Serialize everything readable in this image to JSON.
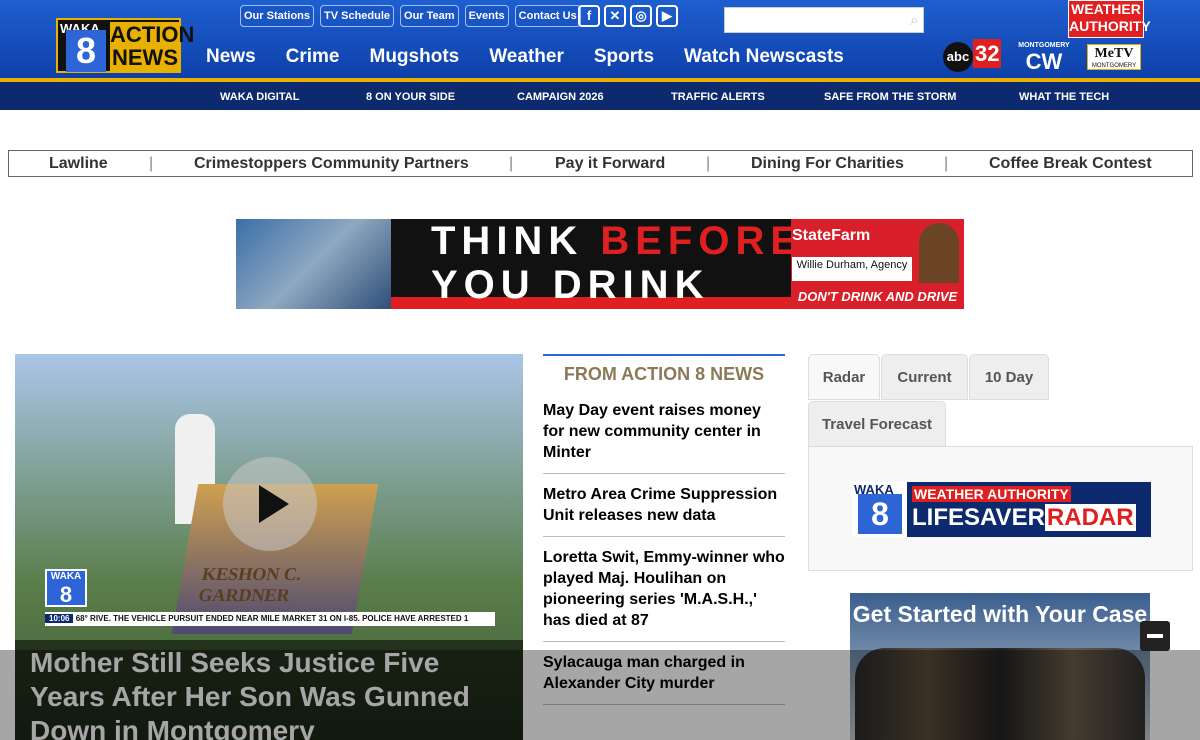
{
  "header": {
    "logo_waka": "WAKA",
    "logo_number": "8",
    "logo_action": "ACTION NEWS",
    "top_links": [
      "Our Stations",
      "TV Schedule",
      "Our Team",
      "Events",
      "Contact Us"
    ],
    "social_icons": [
      "facebook-icon",
      "x-icon",
      "instagram-icon",
      "youtube-icon"
    ],
    "search_placeholder": "",
    "main_nav": [
      "News",
      "Crime",
      "Mugshots",
      "Weather",
      "Sports",
      "Watch Newscasts"
    ],
    "weather_authority": "WEATHER AUTHORITY",
    "abc_logo": "abc",
    "abc_number": "32",
    "cw_small": "MONTGOMERY",
    "cw_logo": "CW",
    "metv_logo": "MeTV",
    "metv_small": "MONTGOMERY"
  },
  "subnav": [
    "WAKA DIGITAL",
    "8 ON YOUR SIDE",
    "CAMPAIGN 2026",
    "TRAFFIC ALERTS",
    "SAFE FROM THE STORM",
    "WHAT THE TECH"
  ],
  "promo_bar": [
    "Lawline",
    "Crimestoppers Community Partners",
    "Pay it Forward",
    "Dining For Charities",
    "Coffee Break Contest"
  ],
  "promo_separator": "|",
  "banner": {
    "line1_a": "THINK ",
    "line1_b": "BEFORE",
    "line2": "YOU DRINK",
    "brand": "StateFarm",
    "agency": "Willie Durham, Agency",
    "slogan": "DON'T DRINK AND DRIVE"
  },
  "video": {
    "grave_text": "KESHON C. GARDNER",
    "logo_text": "WAKA",
    "logo_number": "8",
    "ticker_time": "10:06",
    "ticker_temp": "68°",
    "ticker_text": "RIVE. THE VEHICLE PURSUIT ENDED NEAR MILE MARKET 31 ON I-85. POLICE HAVE ARRESTED 1",
    "headline": "Mother Still Seeks Justice Five Years After Her Son Was Gunned Down in Montgomery"
  },
  "news": {
    "heading": "FROM ACTION 8 NEWS",
    "items": [
      "May Day event raises money for new community center in Minter",
      "Metro Area Crime Suppression Unit releases new data",
      "Loretta Swit, Emmy-winner who played Maj. Houlihan on pioneering series 'M.A.S.H.,' has died at 87",
      "Sylacauga man charged in Alexander City murder"
    ]
  },
  "weather": {
    "tabs": [
      "Radar",
      "Current",
      "10 Day",
      "Travel Forecast"
    ],
    "radar_waka": "WAKA",
    "radar_number": "8",
    "radar_weather_authority": "WEATHER AUTHORITY",
    "radar_lifesaver": "LIFESAVER",
    "radar_radar": "RADAR"
  },
  "legal_ad": {
    "headline": "Get Started with Your Case"
  }
}
